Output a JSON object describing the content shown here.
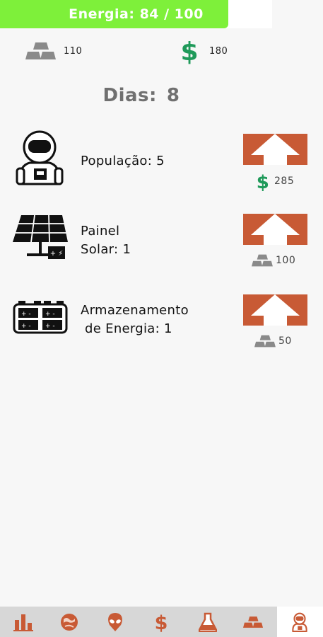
{
  "energy": {
    "label": "Energia: 84 / 100",
    "current": 84,
    "max": 100,
    "fill_color": "#7ef03a"
  },
  "resources": {
    "gold": {
      "icon": "gold-bars-icon",
      "value": "110"
    },
    "money": {
      "icon": "dollar-icon",
      "value": "180"
    }
  },
  "days": {
    "label": "Dias:",
    "value": "8"
  },
  "upgrades": [
    {
      "icon": "astronaut-icon",
      "label": "População: 5",
      "cost_icon": "dollar-icon",
      "cost": "285"
    },
    {
      "icon": "solar-panel-icon",
      "label_line1": "Painel",
      "label_line2": "Solar: 1",
      "cost_icon": "gold-bars-icon",
      "cost": "100"
    },
    {
      "icon": "battery-storage-icon",
      "label_line1": "Armazenamento",
      "label_line2": " de Energia: 1",
      "cost_icon": "gold-bars-icon",
      "cost": "50"
    }
  ],
  "colors": {
    "accent": "#c85a35",
    "money": "#1f9a5a",
    "energy": "#7ef03a"
  },
  "nav": [
    {
      "icon": "bar-chart-icon",
      "active": false
    },
    {
      "icon": "planet-icon",
      "active": false
    },
    {
      "icon": "alien-icon",
      "active": false
    },
    {
      "icon": "dollar-icon",
      "active": false
    },
    {
      "icon": "flask-icon",
      "active": false
    },
    {
      "icon": "gold-bars-icon",
      "active": false
    },
    {
      "icon": "astronaut-icon",
      "active": true
    }
  ]
}
